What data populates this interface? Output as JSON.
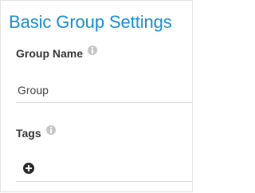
{
  "panel": {
    "title": "Basic Group Settings",
    "accent_color": "#1a90d2"
  },
  "fields": {
    "group_name": {
      "label": "Group Name",
      "info_icon": "info-icon",
      "value": "Group"
    },
    "tags": {
      "label": "Tags",
      "info_icon": "info-icon",
      "add_icon": "plus-circle-icon"
    }
  }
}
